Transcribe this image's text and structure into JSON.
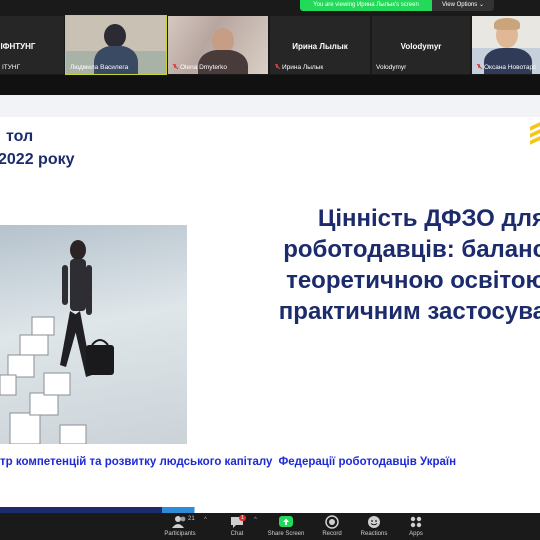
{
  "banner": {
    "viewing_text": "You are viewing Ирина Лылык's screen",
    "view_options_label": "View Options"
  },
  "participants": [
    {
      "name": "О ІФНТУНГ",
      "display_name": "ІТУНГ",
      "has_video": false
    },
    {
      "name": "Людмила Василега",
      "has_video": true,
      "muted": false
    },
    {
      "name": "Olena Dmyterko",
      "has_video": true,
      "muted": true
    },
    {
      "name": "Ирина Лылык",
      "display_name": "Ирина Лылык",
      "has_video": false,
      "muted": true
    },
    {
      "name": "Volodymyr",
      "display_name": "Volodymyr",
      "has_video": false,
      "muted": false
    },
    {
      "name": "Оксана Новотарс",
      "has_video": true,
      "muted": true
    }
  ],
  "slide": {
    "title_line1": "тол",
    "title_line2": "2022 року",
    "headline": [
      "Цінність ДФЗО для",
      "роботодавців: баланс",
      "теоретичною освітою",
      "практичним застосува"
    ],
    "footer_part1": "тр компетенцій та розвитку людського капіталу",
    "footer_part2": "Федерації роботодавців Україн",
    "colors": {
      "title": "#1c2b6b",
      "footer": "#1d2ad6",
      "logo": "#f5c518"
    }
  },
  "toolbar": {
    "participants_count": "21",
    "participants_label": "Participants",
    "chat_label": "Chat",
    "chat_badge": "1",
    "share_label": "Share Screen",
    "record_label": "Record",
    "reactions_label": "Reactions",
    "apps_label": "Apps",
    "share_color": "#23d959"
  }
}
